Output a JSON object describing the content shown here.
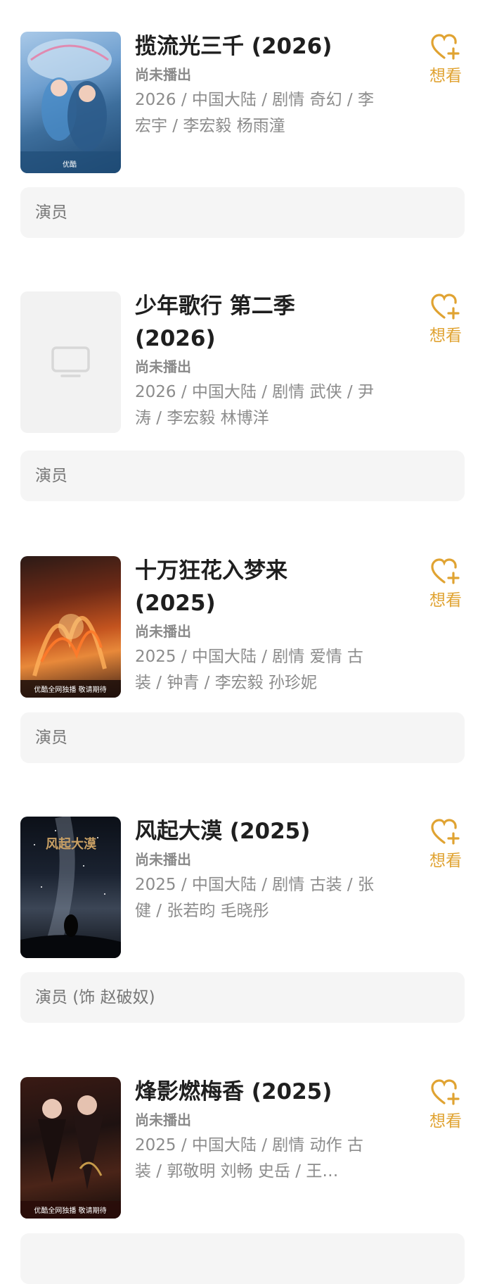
{
  "items": [
    {
      "title": "揽流光三千 (2026)",
      "status": "尚未播出",
      "meta": "2026 / 中国大陆 / 剧情 奇幻 / 李宏宇 / 李宏毅 杨雨潼",
      "want_label": "想看",
      "role": "演员",
      "poster": "poster-image",
      "poster_text": "优酷"
    },
    {
      "title": "少年歌行 第二季 (2026)",
      "status": "尚未播出",
      "meta": "2026 / 中国大陆 / 剧情 武侠 / 尹涛 / 李宏毅 林博洋",
      "want_label": "想看",
      "role": "演员",
      "poster": "placeholder"
    },
    {
      "title": "十万狂花入梦来 (2025)",
      "status": "尚未播出",
      "meta": "2025 / 中国大陆 / 剧情 爱情 古装 / 钟青 / 李宏毅 孙珍妮",
      "want_label": "想看",
      "role": "演员",
      "poster": "poster-image",
      "poster_text": "优酷全网独播 敬请期待"
    },
    {
      "title": "风起大漠 (2025)",
      "status": "尚未播出",
      "meta": "2025 / 中国大陆 / 剧情 古装 / 张健 / 张若昀 毛晓彤",
      "want_label": "想看",
      "role": "演员 (饰 赵破奴)",
      "poster": "poster-image",
      "poster_text": "风起大漠"
    },
    {
      "title": "烽影燃梅香 (2025)",
      "status": "尚未播出",
      "meta": "2025 / 中国大陆 / 剧情 动作 古装 / 郭敬明 刘畅 史岳 / 王…",
      "want_label": "想看",
      "role": "",
      "poster": "poster-image",
      "poster_text": "优酷全网独播 敬请期待"
    }
  ],
  "colors": {
    "accent": "#e0a332",
    "role_bg": "#f5f5f5",
    "meta": "#8c8c8c"
  },
  "icons": {
    "want": "heart-plus-icon",
    "placeholder": "tv-icon"
  }
}
